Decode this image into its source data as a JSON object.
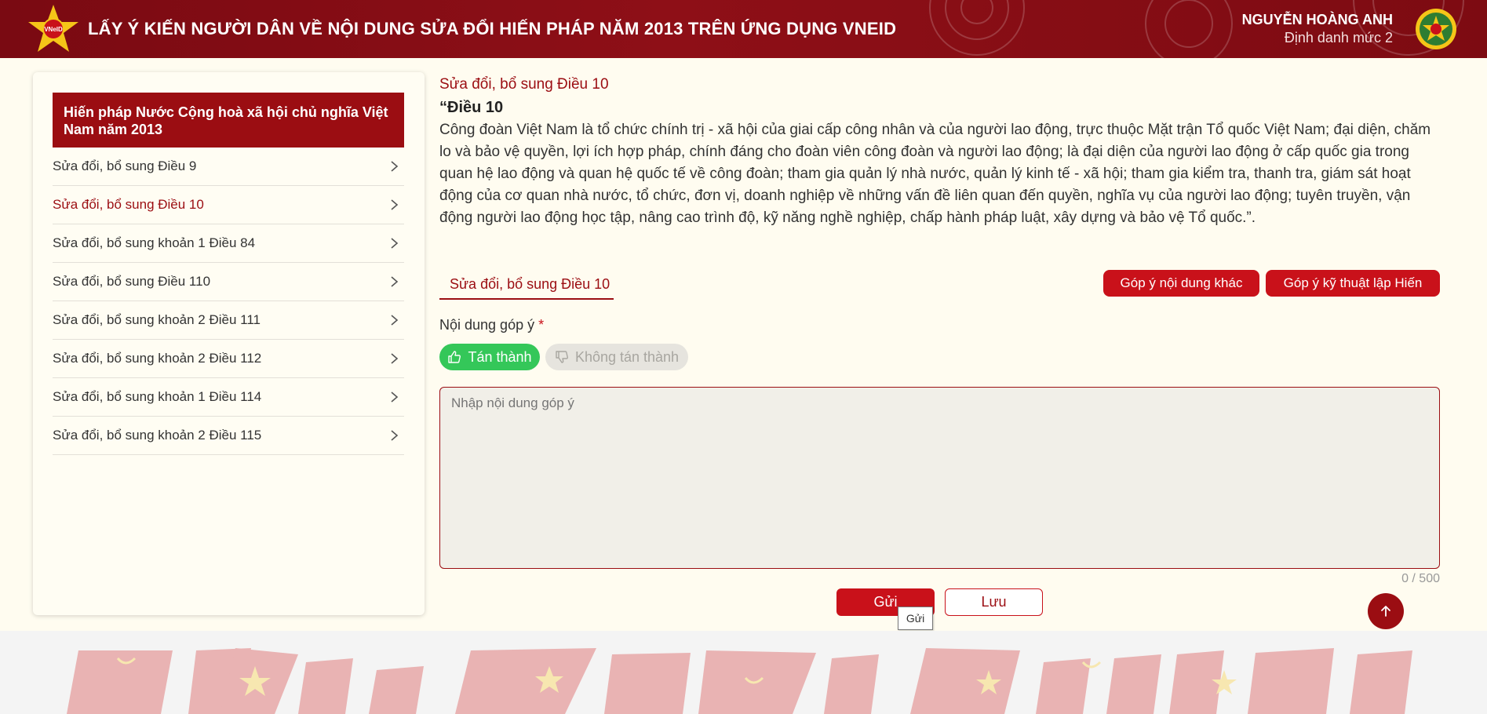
{
  "header": {
    "title": "LẤY Ý KIẾN NGƯỜI DÂN VỀ NỘI DUNG SỬA ĐỔI HIẾN PHÁP NĂM 2013 TRÊN ỨNG DỤNG VNEID",
    "logo_text": "VNeID",
    "user_name": "NGUYỄN HOÀNG ANH",
    "user_level": "Định danh mức 2"
  },
  "sidebar": {
    "heading": "Hiến pháp Nước Cộng hoà xã hội chủ nghĩa Việt Nam năm 2013",
    "items": [
      {
        "label": "Sửa đổi, bổ sung Điều 9"
      },
      {
        "label": "Sửa đổi, bổ sung Điều 10"
      },
      {
        "label": "Sửa đổi, bổ sung khoản 1 Điều 84"
      },
      {
        "label": "Sửa đổi, bổ sung Điều 110"
      },
      {
        "label": "Sửa đổi, bổ sung khoản 2 Điều 111"
      },
      {
        "label": "Sửa đổi, bổ sung khoản 2 Điều 112"
      },
      {
        "label": "Sửa đổi, bổ sung khoản 1 Điều 114"
      },
      {
        "label": "Sửa đổi, bổ sung khoản 2 Điều 115"
      }
    ],
    "active_index": 1
  },
  "main": {
    "section_title": "Sửa đổi, bổ sung Điều 10",
    "article_title": "“Điều 10",
    "article_body": "Công đoàn Việt Nam là tổ chức chính trị - xã hội của giai cấp công nhân và của người lao động, trực thuộc Mặt trận Tổ quốc Việt Nam; đại diện, chăm lo và bảo vệ quyền, lợi ích hợp pháp, chính đáng cho đoàn viên công đoàn và người lao động; là đại diện của người lao động ở cấp quốc gia trong quan hệ lao động và quan hệ quốc tế về công đoàn; tham gia quản lý nhà nước, quản lý kinh tế - xã hội; tham gia kiểm tra, thanh tra, giám sát hoạt động của cơ quan nhà nước, tổ chức, đơn vị, doanh nghiệp về những vấn đề liên quan đến quyền, nghĩa vụ của người lao động; tuyên truyền, vận động người lao động học tập, nâng cao trình độ, kỹ năng nghề nghiệp, chấp hành pháp luật, xây dựng và bảo vệ Tổ quốc.”.",
    "tab_label": "Sửa đổi, bổ sung Điều 10",
    "btn_other": "Góp ý nội dung khác",
    "btn_tech": "Góp ý kỹ thuật lập Hiến",
    "content_label": "Nội dung góp ý",
    "required_mark": "*",
    "agree_label": "Tán thành",
    "disagree_label": "Không tán thành",
    "textarea_placeholder": "Nhập nội dung góp ý",
    "textarea_value": "",
    "counter": "0 / 500",
    "send_label": "Gửi",
    "save_label": "Lưu",
    "tooltip": "Gửi"
  },
  "colors": {
    "brand_red": "#9b0d12",
    "button_red": "#c9111a",
    "agree_green": "#34c759",
    "background": "#fffcf0"
  },
  "icons": {
    "chevron": "chevron-right-icon",
    "agree": "thumbs-up-icon",
    "disagree": "thumbs-down-icon",
    "scroll_top": "arrow-up-icon"
  }
}
